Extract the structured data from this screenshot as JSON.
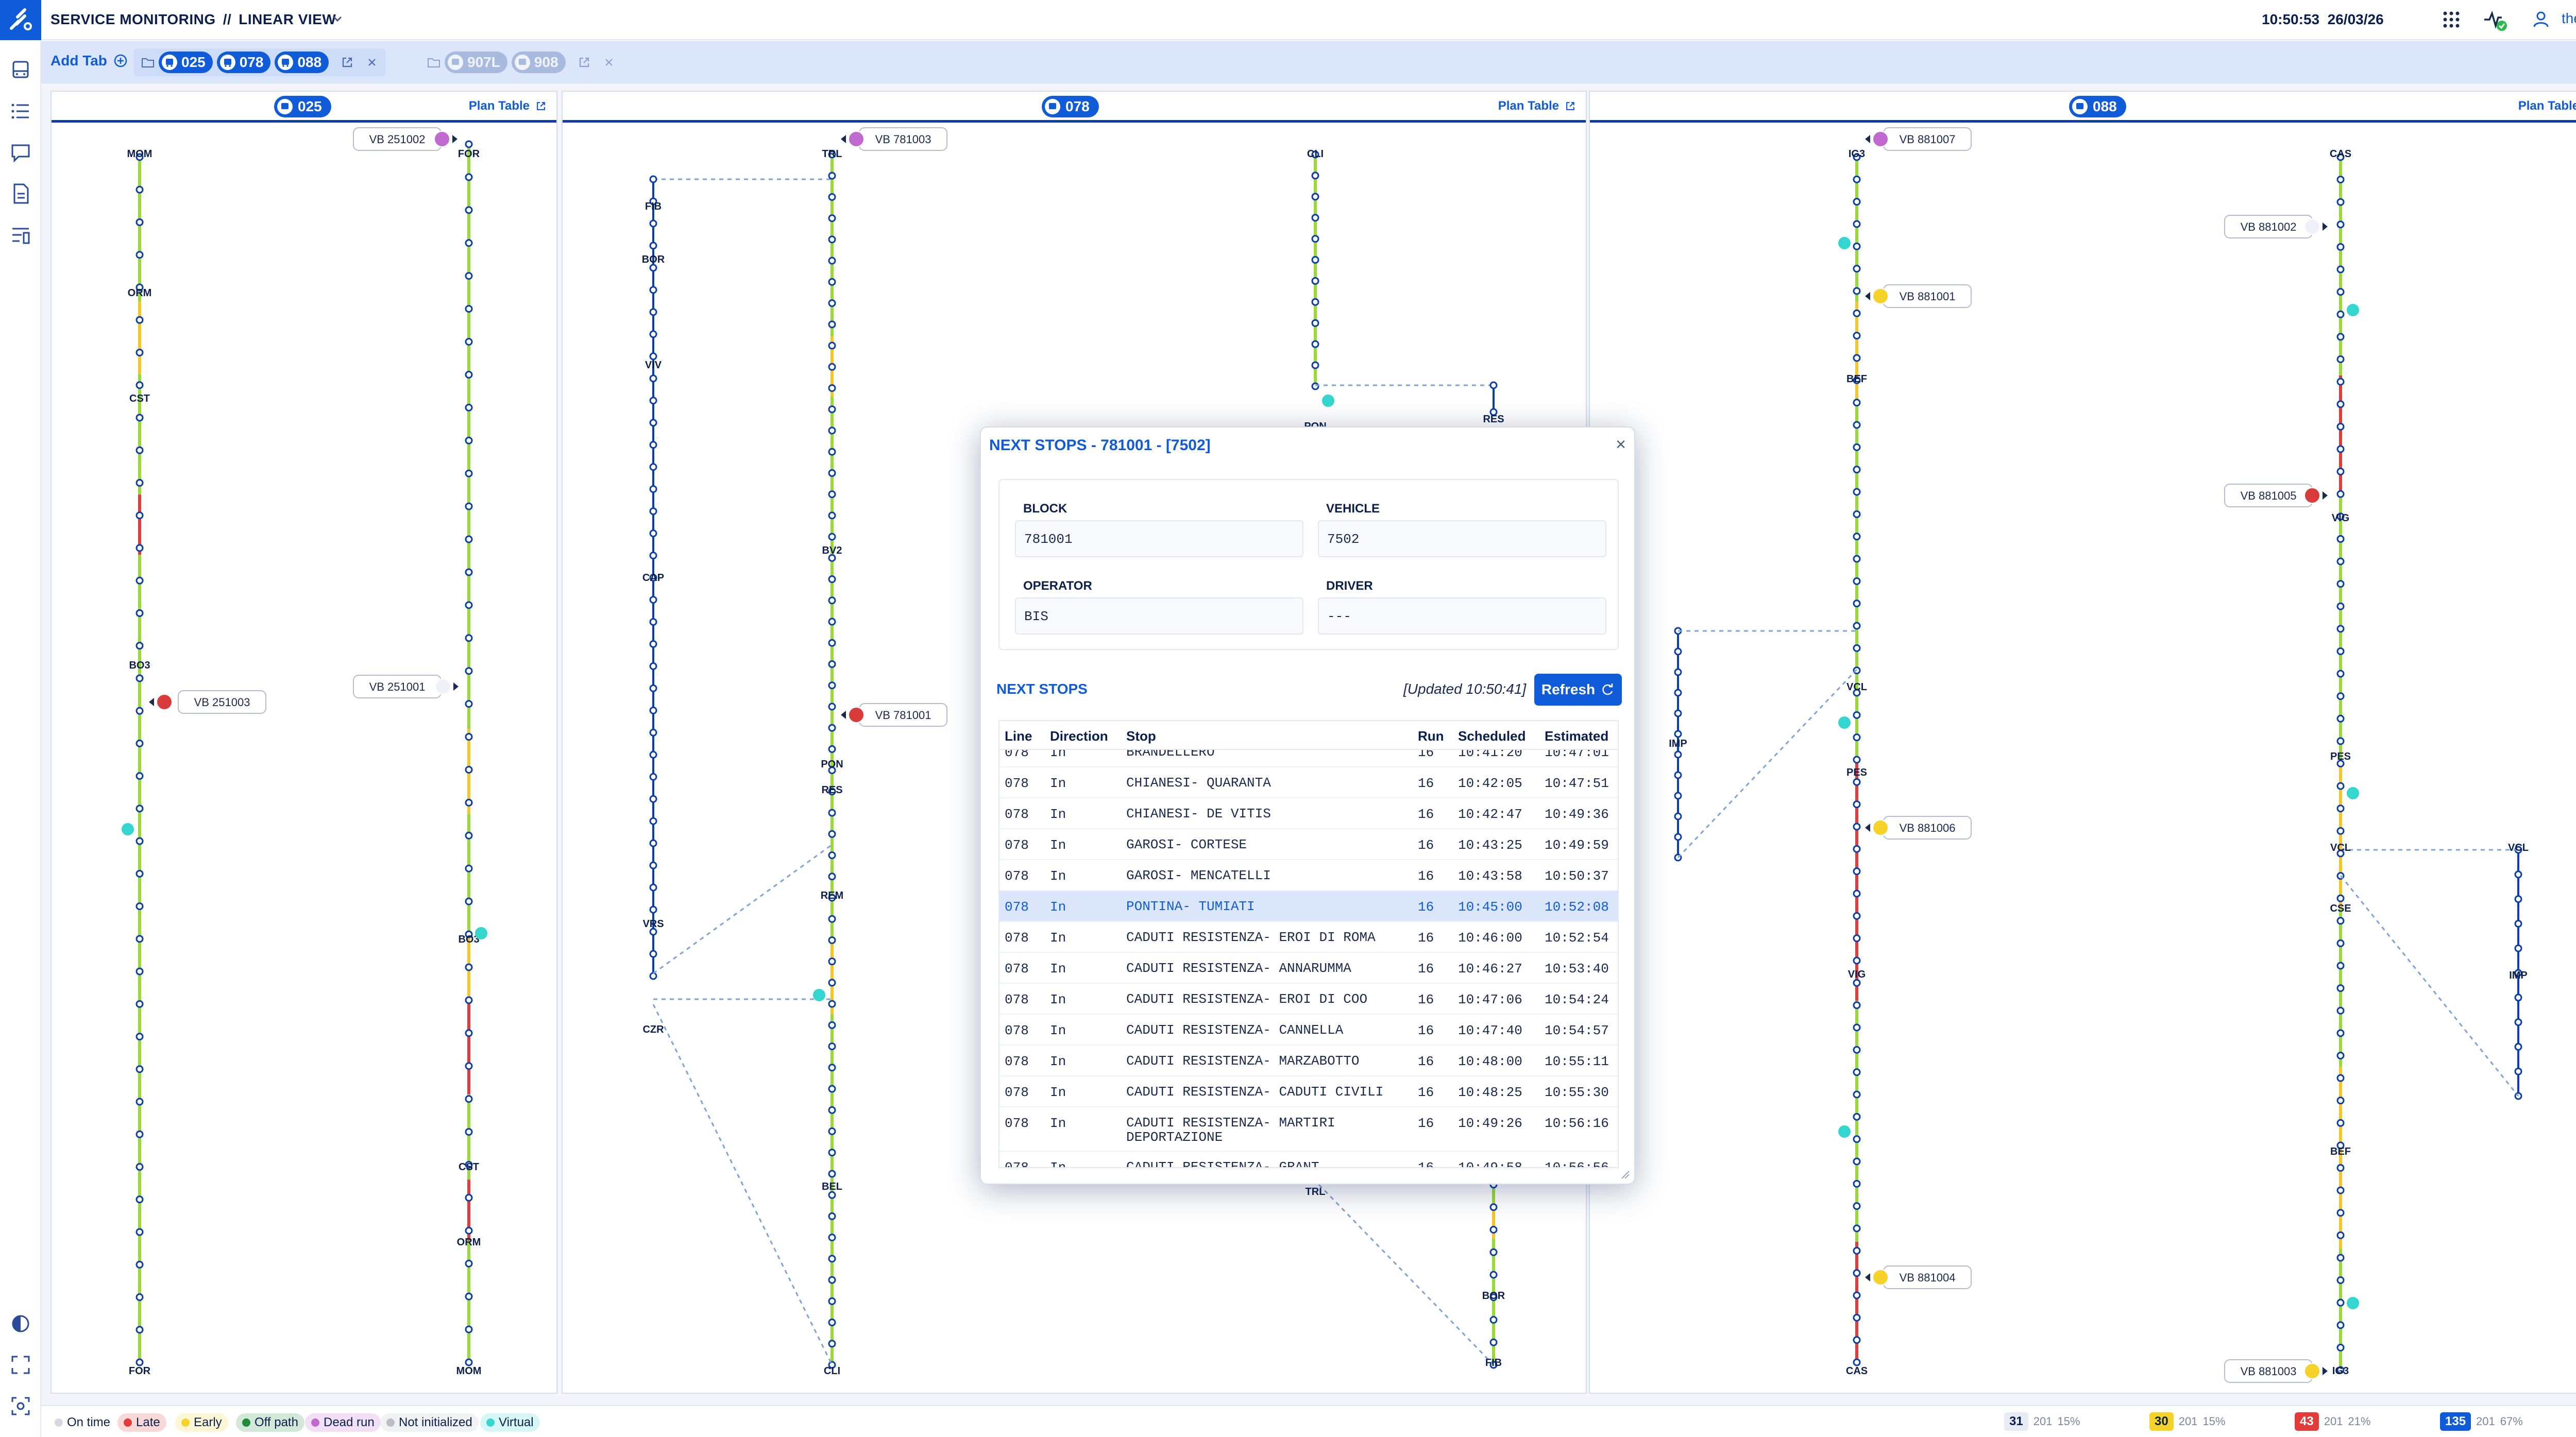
{
  "header": {
    "app_title": "SERVICE MONITORING",
    "separator": "//",
    "view_name": "LINEAR VIEW",
    "time": "10:50:53",
    "date": "26/03/26",
    "username": "thetisit"
  },
  "tabbar": {
    "add_tab_label": "Add Tab",
    "active_group_lines": [
      "025",
      "078",
      "088"
    ],
    "inactive_group_lines": [
      "907L",
      "908"
    ]
  },
  "panels": [
    {
      "line": "025",
      "plan_label": "Plan Table"
    },
    {
      "line": "078",
      "plan_label": "Plan Table"
    },
    {
      "line": "088",
      "plan_label": "Plan Table"
    }
  ],
  "diagram": {
    "stop_labels_025_left": [
      "MOM",
      "ORM",
      "CST",
      "BO3",
      "FOR"
    ],
    "stop_labels_025_right": [
      "FOR",
      "BO3",
      "CST",
      "ORM",
      "MOM"
    ],
    "stop_labels_078_a": [
      "FIB",
      "BOR",
      "VIV",
      "CAP",
      "VRS",
      "CZR"
    ],
    "stop_labels_078_b": [
      "TRL",
      "BV2",
      "PON",
      "RES",
      "REM",
      "BEL",
      "CLI"
    ],
    "stop_labels_078_c": [
      "CLI",
      "PON",
      "TRL"
    ],
    "stop_labels_078_d": [
      "RES",
      "BOR",
      "FIB"
    ],
    "stop_labels_088_a": [
      "IG3",
      "BEF",
      "VCL",
      "PES",
      "VIG",
      "CAS"
    ],
    "stop_labels_088_b": [
      "IMP"
    ],
    "stop_labels_088_c": [
      "CAS",
      "VIG",
      "PES",
      "VCL",
      "CSE",
      "BEF",
      "IG3"
    ],
    "stop_labels_088_d": [
      "VCL",
      "IMP"
    ],
    "vehicles": [
      "VB 251002",
      "VB 251001",
      "VB 251003",
      "VB 781003",
      "VB 781001",
      "VB 881007",
      "VB 881002",
      "VB 881001",
      "VB 881005",
      "VB 881006",
      "VB 881004",
      "VB 881003"
    ]
  },
  "dialog": {
    "title": "NEXT STOPS - 781001 - [7502]",
    "block_label": "BLOCK",
    "block_value": "781001",
    "vehicle_label": "VEHICLE",
    "vehicle_value": "7502",
    "operator_label": "OPERATOR",
    "operator_value": "BIS",
    "driver_label": "DRIVER",
    "driver_value": "---",
    "next_stops_title": "NEXT STOPS",
    "updated": "[Updated 10:50:41]",
    "refresh_label": "Refresh",
    "columns": [
      "Line",
      "Direction",
      "Stop",
      "Run",
      "Scheduled",
      "Estimated"
    ],
    "rows": [
      {
        "line": "078",
        "dir": "In",
        "stop": "BRANDELLERO",
        "run": "16",
        "sched": "10:41:20",
        "est": "10:47:01"
      },
      {
        "line": "078",
        "dir": "In",
        "stop": "CHIANESI- QUARANTA",
        "run": "16",
        "sched": "10:42:05",
        "est": "10:47:51"
      },
      {
        "line": "078",
        "dir": "In",
        "stop": "CHIANESI- DE VITIS",
        "run": "16",
        "sched": "10:42:47",
        "est": "10:49:36"
      },
      {
        "line": "078",
        "dir": "In",
        "stop": "GAROSI- CORTESE",
        "run": "16",
        "sched": "10:43:25",
        "est": "10:49:59"
      },
      {
        "line": "078",
        "dir": "In",
        "stop": "GAROSI- MENCATELLI",
        "run": "16",
        "sched": "10:43:58",
        "est": "10:50:37"
      },
      {
        "line": "078",
        "dir": "In",
        "stop": "PONTINA- TUMIATI",
        "run": "16",
        "sched": "10:45:00",
        "est": "10:52:08"
      },
      {
        "line": "078",
        "dir": "In",
        "stop": "CADUTI RESISTENZA- EROI DI ROMA",
        "run": "16",
        "sched": "10:46:00",
        "est": "10:52:54"
      },
      {
        "line": "078",
        "dir": "In",
        "stop": "CADUTI RESISTENZA- ANNARUMMA",
        "run": "16",
        "sched": "10:46:27",
        "est": "10:53:40"
      },
      {
        "line": "078",
        "dir": "In",
        "stop": "CADUTI RESISTENZA- EROI DI COO",
        "run": "16",
        "sched": "10:47:06",
        "est": "10:54:24"
      },
      {
        "line": "078",
        "dir": "In",
        "stop": "CADUTI RESISTENZA- CANNELLA",
        "run": "16",
        "sched": "10:47:40",
        "est": "10:54:57"
      },
      {
        "line": "078",
        "dir": "In",
        "stop": "CADUTI RESISTENZA- MARZABOTTO",
        "run": "16",
        "sched": "10:48:00",
        "est": "10:55:11"
      },
      {
        "line": "078",
        "dir": "In",
        "stop": "CADUTI RESISTENZA- CADUTI CIVILI",
        "run": "16",
        "sched": "10:48:25",
        "est": "10:55:30"
      },
      {
        "line": "078",
        "dir": "In",
        "stop": "CADUTI RESISTENZA- MARTIRI DEPORTAZIONE",
        "run": "16",
        "sched": "10:49:26",
        "est": "10:56:16"
      },
      {
        "line": "078",
        "dir": "In",
        "stop": "CADUTI RESISTENZA- GRANT",
        "run": "16",
        "sched": "10:49:58",
        "est": "10:56:56"
      }
    ],
    "selected_row": 5
  },
  "statusbar": {
    "legend": [
      {
        "label": "On time",
        "color": "#d5d9e2"
      },
      {
        "label": "Late",
        "color": "#e23b3b"
      },
      {
        "label": "Early",
        "color": "#f5d32a"
      },
      {
        "label": "Off path",
        "color": "#1f8a3a"
      },
      {
        "label": "Dead run",
        "color": "#c06ad0"
      },
      {
        "label": "Not initialized",
        "color": "#b9bec8"
      },
      {
        "label": "Virtual",
        "color": "#35d6d0"
      }
    ],
    "stats": [
      {
        "count": "31",
        "a": "201",
        "b": "15%"
      },
      {
        "count": "30",
        "a": "201",
        "b": "15%"
      },
      {
        "count": "43",
        "a": "201",
        "b": "21%"
      },
      {
        "count": "135",
        "a": "201",
        "b": "67%"
      }
    ]
  },
  "colors": {
    "accent": "#0f5bd8",
    "on_time_segment": "#9ad93a",
    "early_segment": "#f5c52a",
    "late_segment": "#e23b3b",
    "route": "#0b3ea8"
  }
}
